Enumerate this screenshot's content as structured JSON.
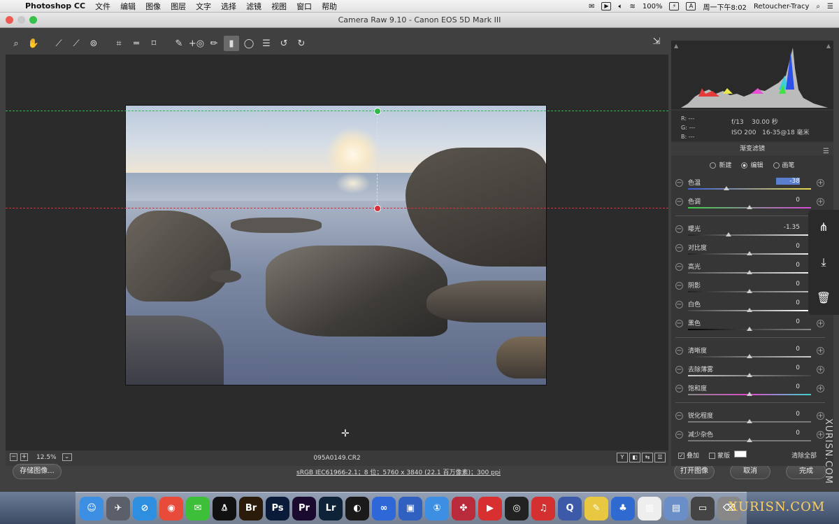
{
  "menubar": {
    "app": "Photoshop CC",
    "items": [
      "文件",
      "编辑",
      "图像",
      "图层",
      "文字",
      "选择",
      "滤镜",
      "视图",
      "窗口",
      "帮助"
    ],
    "battery": "100%",
    "clock": "周一下午8:02",
    "user": "Retoucher-Tracy"
  },
  "window": {
    "title": "Camera Raw 9.10 -  Canon EOS 5D Mark III"
  },
  "toolbar": {
    "tools": [
      "zoom-icon",
      "hand-icon",
      "white-balance-icon",
      "color-sampler-icon",
      "target-adjust-icon",
      "crop-icon",
      "straighten-icon",
      "transform-icon",
      "spot-removal-icon",
      "red-eye-icon",
      "brush-icon",
      "graduated-filter-icon",
      "radial-filter-icon",
      "preferences-icon",
      "rotate-ccw-icon",
      "rotate-cw-icon"
    ]
  },
  "status": {
    "zoom": "12.5%",
    "filename": "095A0149.CR2",
    "view_buttons": [
      "Y",
      "◧",
      "⇆",
      "☰"
    ]
  },
  "bottom": {
    "save_label": "存储图像...",
    "workflow": "sRGB IEC61966-2.1；8 位；5760 x 3840 (22.1 百万像素)；300 ppi",
    "open_label": "打开图像",
    "cancel_label": "取消",
    "done_label": "完成"
  },
  "info": {
    "r": "R:   ---",
    "g": "G:   ---",
    "b": "B:   ---",
    "aperture": "f/13",
    "shutter": "30.00 秒",
    "iso": "ISO 200",
    "lens": "16-35@18 毫米"
  },
  "panel": {
    "title": "渐变滤镜",
    "modes": {
      "new": "新建",
      "edit": "编辑",
      "brush": "画笔"
    },
    "sliders": [
      {
        "label": "色温",
        "value": "-38",
        "level": 0.31,
        "selected": true
      },
      {
        "label": "色调",
        "value": "0",
        "level": 0.5
      },
      {
        "label": "曝光",
        "value": "-1.35",
        "level": 0.33
      },
      {
        "label": "对比度",
        "value": "0",
        "level": 0.5
      },
      {
        "label": "高光",
        "value": "0",
        "level": 0.5
      },
      {
        "label": "阴影",
        "value": "0",
        "level": 0.5
      },
      {
        "label": "白色",
        "value": "0",
        "level": 0.5
      },
      {
        "label": "黑色",
        "value": "0",
        "level": 0.5
      },
      {
        "label": "清晰度",
        "value": "0",
        "level": 0.5
      },
      {
        "label": "去除薄雾",
        "value": "0",
        "level": 0.5
      },
      {
        "label": "饱和度",
        "value": "0",
        "level": 0.5
      },
      {
        "label": "锐化程度",
        "value": "0",
        "level": 0.5
      },
      {
        "label": "减少杂色",
        "value": "0",
        "level": 0.5
      }
    ],
    "overlay_label": "叠加",
    "mask_label": "蒙版",
    "clear_all_label": "清除全部"
  },
  "colors": {
    "accent_selected": "#5a7fcf",
    "guide_green": "#2fb84a",
    "guide_red": "#d8303a"
  },
  "dock": [
    "Finder",
    "Launchpad",
    "Safari",
    "Chrome",
    "WeChat",
    "QQ",
    "Br",
    "Ps",
    "Pr",
    "Lr",
    "Motion",
    "Baidu",
    "Video",
    "1Password",
    "DaVinci",
    "Play",
    "OBS",
    "NetEase",
    "QuickTime",
    "Notes",
    "Keynote",
    "Stats",
    "Preview",
    "Display",
    "Trash"
  ],
  "watermark": {
    "side": "XURISN.COM",
    "dock": "XURISN.COM"
  }
}
